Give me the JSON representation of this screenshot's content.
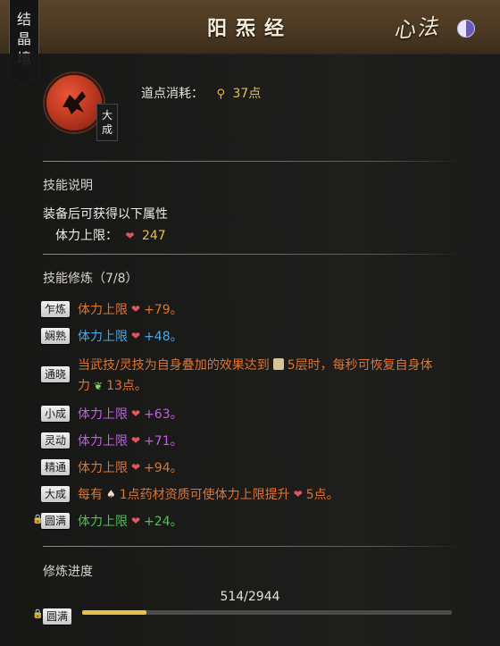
{
  "header": {
    "title": "阳炁经",
    "category": "心法",
    "realm": [
      "结",
      "晶",
      "境"
    ]
  },
  "skill": {
    "rank": [
      "大",
      "成"
    ],
    "cost_label": "道点消耗：",
    "cost_value": "37点"
  },
  "description": {
    "section_title": "技能说明",
    "text": "装备后可获得以下属性",
    "stat_label": "体力上限：",
    "stat_value": "247"
  },
  "cultivation": {
    "section_title": "技能修炼（7/8）",
    "stages": [
      {
        "tag": "乍炼",
        "label": "体力上限",
        "value": "+79。",
        "color": "orange"
      },
      {
        "tag": "娴熟",
        "label": "体力上限",
        "value": "+48。",
        "color": "blue"
      },
      {
        "tag": "通晓",
        "text_a": "当武技/灵技为自身叠加的效果达到",
        "text_b": "5层时，每秒可恢复自身体力",
        "text_c": "13点。",
        "color": "orange"
      },
      {
        "tag": "小成",
        "label": "体力上限",
        "value": "+63。",
        "color": "purple"
      },
      {
        "tag": "灵动",
        "label": "体力上限",
        "value": "+71。",
        "color": "purple"
      },
      {
        "tag": "精通",
        "label": "体力上限",
        "value": "+94。",
        "color": "orange"
      },
      {
        "tag": "大成",
        "text_a": "每有",
        "text_b": "1点药材资质可使体力上限提升",
        "text_c": "5点。",
        "color": "orange"
      },
      {
        "tag": "圆满",
        "label": "体力上限",
        "value": "+24。",
        "color": "green"
      }
    ]
  },
  "progress": {
    "section_title": "修炼进度",
    "text": "514/2944",
    "current": 514,
    "max": 2944,
    "next_tag": "圆满"
  },
  "colors": {
    "gold": "#e6c14a",
    "orange": "#e0742e",
    "blue": "#4aa8e8",
    "purple": "#c85ae8",
    "green": "#48c848",
    "heart": "#e05560"
  }
}
